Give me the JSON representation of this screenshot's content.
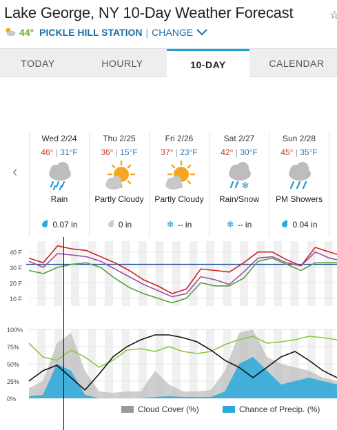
{
  "header": {
    "title": "Lake George, NY 10-Day Weather Forecast",
    "current_temp": "44°",
    "station": "PICKLE HILL STATION",
    "separator": "|",
    "change_label": "CHANGE"
  },
  "tabs": [
    {
      "label": "TODAY",
      "active": false
    },
    {
      "label": "HOURLY",
      "active": false
    },
    {
      "label": "10-DAY",
      "active": true
    },
    {
      "label": "CALENDAR",
      "active": false
    }
  ],
  "days": [
    {
      "date": "Wed 2/24",
      "high": "46°",
      "low": "31°F",
      "condition": "Rain",
      "icon": "rain-icon",
      "precip": "0.07 in",
      "precip_icon": "raindrop-icon"
    },
    {
      "date": "Thu 2/25",
      "high": "36°",
      "low": "15°F",
      "condition": "Partly Cloudy",
      "icon": "partly-cloudy-icon",
      "precip": "0 in",
      "precip_icon": "dry-drop-icon"
    },
    {
      "date": "Fri 2/26",
      "high": "37°",
      "low": "23°F",
      "condition": "Partly Cloudy",
      "icon": "partly-cloudy-icon",
      "precip": "-- in",
      "precip_icon": "snowflake-icon"
    },
    {
      "date": "Sat 2/27",
      "high": "42°",
      "low": "30°F",
      "condition": "Rain/Snow",
      "icon": "rain-snow-icon",
      "precip": "-- in",
      "precip_icon": "snowflake-icon"
    },
    {
      "date": "Sun 2/28",
      "high": "45°",
      "low": "35°F",
      "condition": "PM Showers",
      "icon": "showers-icon",
      "precip": "0.04 in",
      "precip_icon": "raindrop-icon"
    }
  ],
  "chart_data": [
    {
      "type": "line",
      "yticks": [
        "40 F",
        "30 F",
        "20 F",
        "10 F"
      ],
      "ylim": [
        5,
        47
      ],
      "freezing_line": 32,
      "x": [
        0,
        6,
        12,
        18,
        24,
        30,
        36,
        42,
        48,
        54,
        60,
        66,
        72,
        78,
        84,
        90,
        96,
        102,
        108,
        114,
        120,
        126,
        132
      ],
      "series": [
        {
          "color": "#cc2222",
          "values": [
            36,
            33,
            44,
            42,
            41,
            37,
            33,
            28,
            22,
            18,
            13,
            16,
            29,
            28,
            27,
            33,
            40,
            40,
            35,
            31,
            43,
            40,
            37
          ]
        },
        {
          "color": "#9b4fa0",
          "values": [
            34,
            30,
            39,
            38,
            37,
            34,
            29,
            24,
            19,
            15,
            11,
            13,
            24,
            22,
            19,
            27,
            36,
            37,
            33,
            31,
            40,
            36,
            34
          ]
        },
        {
          "color": "#55a040",
          "values": [
            28,
            26,
            30,
            32,
            33,
            30,
            23,
            17,
            13,
            10,
            7,
            10,
            20,
            18,
            18,
            23,
            34,
            36,
            32,
            28,
            33,
            33,
            33
          ]
        }
      ]
    },
    {
      "type": "area",
      "yticks": [
        "100%",
        "75%",
        "50%",
        "25%",
        "0%"
      ],
      "ylim": [
        0,
        100
      ],
      "x": [
        0,
        6,
        12,
        18,
        24,
        30,
        36,
        42,
        48,
        54,
        60,
        66,
        72,
        78,
        84,
        90,
        96,
        102,
        108,
        114,
        120,
        126,
        132
      ],
      "series": [
        {
          "name": "Cloud Cover (%)",
          "type": "area",
          "color": "#bbbbbb",
          "values": [
            15,
            25,
            80,
            95,
            40,
            10,
            8,
            10,
            10,
            40,
            20,
            10,
            10,
            12,
            40,
            95,
            100,
            60,
            50,
            45,
            40,
            30,
            25
          ]
        },
        {
          "name": "Chance of Precip. (%)",
          "type": "area",
          "color": "#2aa9dd",
          "values": [
            3,
            5,
            50,
            40,
            5,
            0,
            0,
            0,
            0,
            2,
            3,
            2,
            2,
            2,
            10,
            50,
            60,
            40,
            20,
            25,
            30,
            25,
            20
          ]
        },
        {
          "type": "line",
          "color": "#8cc63f",
          "values": [
            80,
            60,
            55,
            70,
            60,
            45,
            55,
            70,
            72,
            68,
            75,
            68,
            65,
            68,
            78,
            85,
            90,
            80,
            82,
            85,
            90,
            88,
            85
          ]
        },
        {
          "type": "line",
          "color": "#111111",
          "values": [
            25,
            40,
            48,
            30,
            12,
            35,
            60,
            75,
            85,
            92,
            92,
            88,
            82,
            70,
            55,
            45,
            30,
            45,
            60,
            68,
            55,
            40,
            30
          ]
        }
      ]
    }
  ]
}
